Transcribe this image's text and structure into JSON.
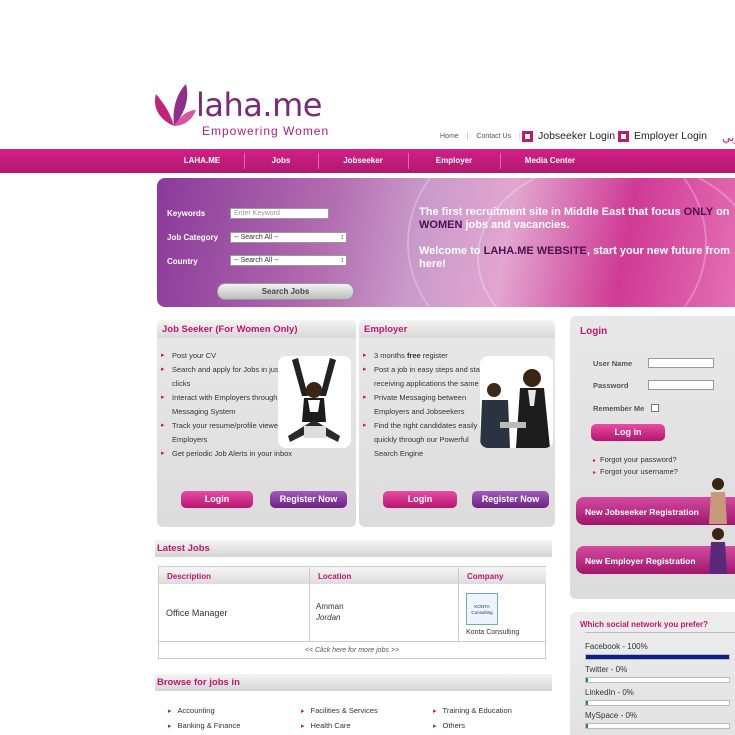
{
  "header": {
    "logo_text": "laha.me",
    "tagline": "Empowering Women",
    "links": [
      "Home",
      "Contact Us"
    ],
    "jobseeker_login": "Jobseeker Login",
    "employer_login": "Employer Login",
    "arabic_link": "عربي"
  },
  "nav": {
    "items": [
      "LAHA.ME",
      "Jobs",
      "Jobseeker",
      "Employer",
      "Media Center"
    ]
  },
  "banner": {
    "keywords_label": "Keywords",
    "keywords_placeholder": "Enter Keyword",
    "category_label": "Job Category",
    "category_value": "-- Search All --",
    "country_label": "Country",
    "country_value": "-- Search All --",
    "search_button": "Search Jobs",
    "headline_part1": "The first recruitment site in Middle East that focus ",
    "headline_only": "ONLY",
    "headline_part2": " on ",
    "headline_women": "WOMEN",
    "headline_part3": " jobs and vacancies.",
    "welcome_part1": "Welcome to ",
    "welcome_site": "LAHA.ME WEBSITE",
    "welcome_part2": ", start your new future from here!"
  },
  "jobseeker": {
    "title": "Job Seeker (For Women Only)",
    "bullets": [
      "Post your CV",
      "Search and apply for Jobs in just a few clicks",
      "Interact with Employers through Private Messaging System",
      "Track your resume/profile viewed by Employers",
      "Get periodic Job Alerts in your inbox"
    ],
    "login": "Login",
    "register": "Register Now"
  },
  "employer": {
    "title": "Employer",
    "bullet1_a": "3 months ",
    "bullet1_b": "free",
    "bullet1_c": " register",
    "bullets": [
      "Post a job in easy steps and start receiving applications the same day",
      "Private Messaging between Employers and Jobseekers",
      "Find the right candidates easily and quickly through our Powerful Search Engine"
    ],
    "login": "Login",
    "register": "Register Now"
  },
  "login_box": {
    "title": "Login",
    "username_label": "User Name",
    "password_label": "Password",
    "remember_label": "Remember Me",
    "login_button": "Log in",
    "forgot_password": "Forgot your password?",
    "forgot_username": "Forgot your username?",
    "new_jobseeker": "New Jobseeker Registration",
    "new_employer": "New Employer Registration"
  },
  "latest_jobs": {
    "title": "Latest Jobs",
    "columns": [
      "Description",
      "Location",
      "Company"
    ],
    "rows": [
      {
        "description": "Office Manager",
        "city": "Amman",
        "country": "Jordan",
        "company": "Konta Consulting",
        "logo_text": "KONTA Consulting"
      }
    ],
    "more": "<< Click here for more jobs >>"
  },
  "browse": {
    "title": "Browse for jobs in",
    "items": [
      "Accounting",
      "Facilities & Services",
      "Training & Education",
      "Banking & Finance",
      "Health Care",
      "Others"
    ]
  },
  "poll": {
    "question": "Which social network you prefer?",
    "options": [
      {
        "label": "Facebook - 100%",
        "value": 100,
        "color": "#0b1f8c"
      },
      {
        "label": "Twitter - 0%",
        "value": 0,
        "color": "#1a8a6a"
      },
      {
        "label": "LinkedIn - 0%",
        "value": 0,
        "color": "#1a8a6a"
      },
      {
        "label": "MySpace - 0%",
        "value": 0,
        "color": "#1a8a6a"
      }
    ]
  },
  "colors": {
    "brand_pink": "#c0176f",
    "brand_purple": "#7a2a78",
    "nav_bg": "#c81c80"
  }
}
